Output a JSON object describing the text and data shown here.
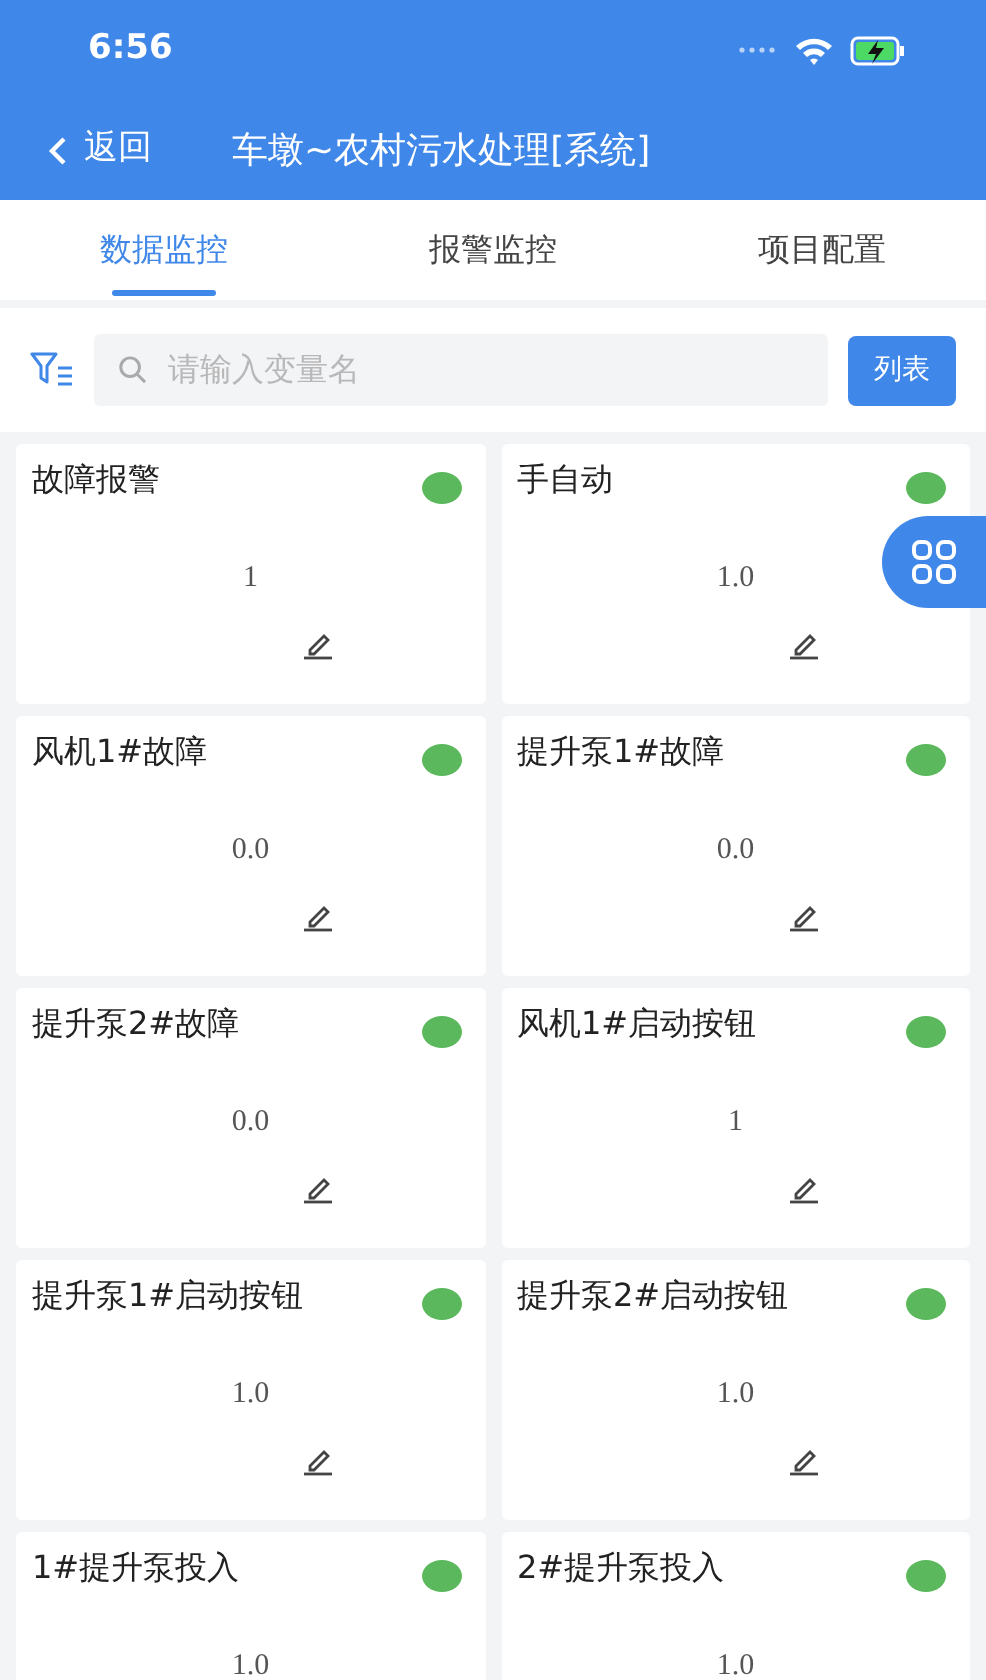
{
  "status_bar": {
    "time": "6:56"
  },
  "header": {
    "back": "返回",
    "title": "车墩~农村污水处理[系统]"
  },
  "tabs": [
    {
      "label": "数据监控",
      "selected": true
    },
    {
      "label": "报警监控",
      "selected": false
    },
    {
      "label": "项目配置",
      "selected": false
    }
  ],
  "search": {
    "placeholder": "请输入变量名",
    "button": "列表"
  },
  "cards": [
    {
      "name": "故障报警",
      "value": "1",
      "color": "#5cb85c",
      "editable": true
    },
    {
      "name": "手自动",
      "value": "1.0",
      "color": "#5cb85c",
      "editable": true
    },
    {
      "name": "风机1#故障",
      "value": "0.0",
      "color": "#5cb85c",
      "editable": true
    },
    {
      "name": "提升泵1#故障",
      "value": "0.0",
      "color": "#5cb85c",
      "editable": true
    },
    {
      "name": "提升泵2#故障",
      "value": "0.0",
      "color": "#5cb85c",
      "editable": true
    },
    {
      "name": "风机1#启动按钮",
      "value": "1",
      "color": "#5cb85c",
      "editable": true
    },
    {
      "name": "提升泵1#启动按钮",
      "value": "1.0",
      "color": "#5cb85c",
      "editable": true
    },
    {
      "name": "提升泵2#启动按钮",
      "value": "1.0",
      "color": "#5cb85c",
      "editable": true
    },
    {
      "name": "1#提升泵投入",
      "value": "1.0",
      "color": "#5cb85c"
    },
    {
      "name": "2#提升泵投入",
      "value": "1.0",
      "color": "#5cb85c"
    }
  ]
}
